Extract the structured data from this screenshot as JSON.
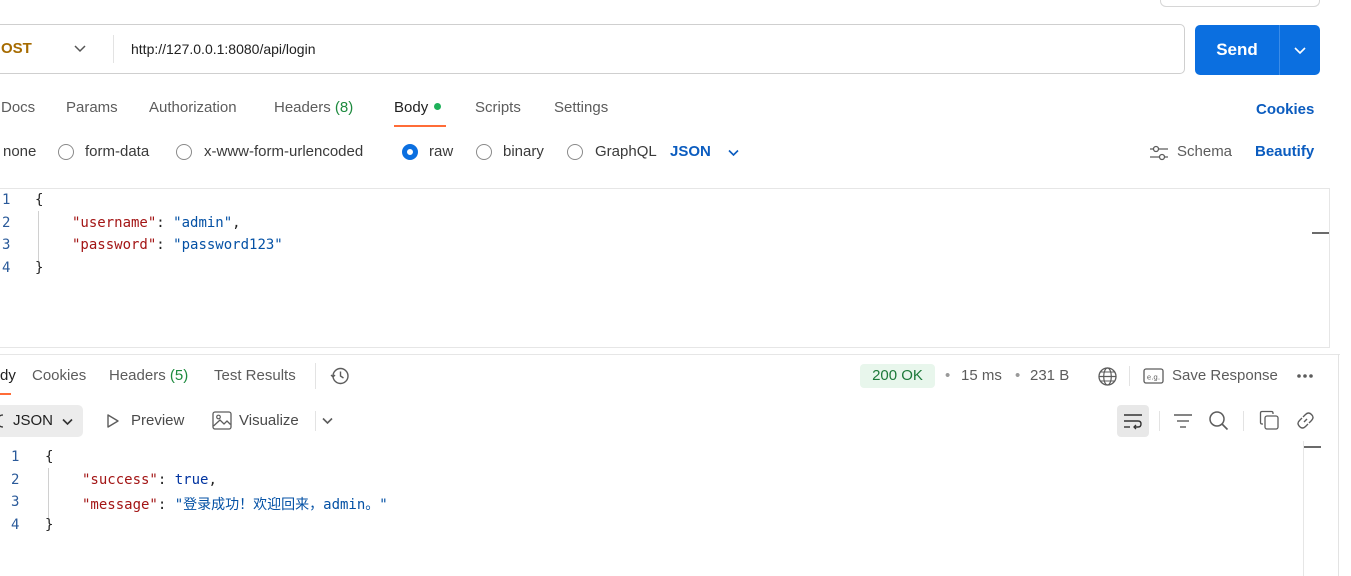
{
  "request": {
    "method": "OST",
    "url": "http://127.0.0.1:8080/api/login",
    "send_label": "Send"
  },
  "request_tabs": [
    {
      "label": "Docs"
    },
    {
      "label": "Params"
    },
    {
      "label": "Authorization"
    },
    {
      "label": "Headers",
      "count": "(8)"
    },
    {
      "label": "Body"
    },
    {
      "label": "Scripts"
    },
    {
      "label": "Settings"
    }
  ],
  "cookies_label": "Cookies",
  "body_types": {
    "none": "none",
    "form_data": "form-data",
    "urlencoded": "x-www-form-urlencoded",
    "raw": "raw",
    "binary": "binary",
    "graphql": "GraphQL",
    "format": "JSON",
    "selected": "raw"
  },
  "schema_label": "Schema",
  "beautify_label": "Beautify",
  "request_body": {
    "line_numbers": [
      "1",
      "2",
      "3",
      "4"
    ],
    "open": "{",
    "close": "}",
    "username_key": "\"username\"",
    "username_val": "\"admin\"",
    "password_key": "\"password\"",
    "password_val": "\"password123\""
  },
  "response_tabs": [
    {
      "label": "dy"
    },
    {
      "label": "Cookies"
    },
    {
      "label": "Headers",
      "count": "(5)"
    },
    {
      "label": "Test Results"
    }
  ],
  "response_meta": {
    "status": "200 OK",
    "time": "15 ms",
    "size": "231 B",
    "separator": "•",
    "save_label": "Save Response"
  },
  "response_toolbar": {
    "format": "JSON",
    "preview": "Preview",
    "visualize": "Visualize"
  },
  "response_body": {
    "line_numbers": [
      "1",
      "2",
      "3",
      "4"
    ],
    "open": "{",
    "close": "}",
    "success_key": "\"success\"",
    "success_val": "true",
    "message_key": "\"message\"",
    "message_val": "\"登录成功！欢迎回来，admin。\""
  },
  "colors": {
    "accent": "#0b6fe0",
    "tab_underline": "#ff6c37",
    "status_ok": "#1d7a3a"
  }
}
